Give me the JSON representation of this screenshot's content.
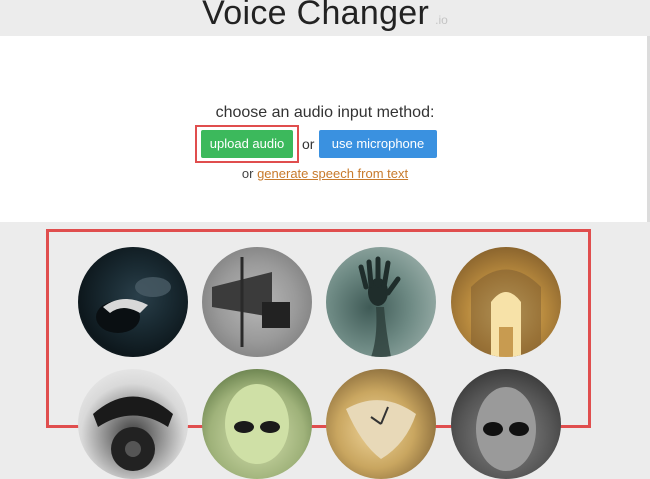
{
  "header": {
    "title": "Voice Changer",
    "suffix": ".io"
  },
  "input_panel": {
    "prompt": "choose an audio input method:",
    "upload_label": "upload audio",
    "or_text": "or",
    "mic_label": "use microphone",
    "or_prefix": "or",
    "generate_link": "generate speech from text"
  },
  "voices": [
    {
      "name": "dark-creature-thumbnail"
    },
    {
      "name": "megaphone-thumbnail"
    },
    {
      "name": "ghost-hand-thumbnail"
    },
    {
      "name": "cathedral-thumbnail"
    },
    {
      "name": "telephone-thumbnail"
    },
    {
      "name": "alien-thumbnail"
    },
    {
      "name": "melting-clock-thumbnail"
    },
    {
      "name": "grey-alien-thumbnail"
    }
  ],
  "colors": {
    "upload_green": "#3cb95c",
    "mic_blue": "#3a91e0",
    "highlight_red": "#e04e4e",
    "link_orange": "#c87a2b"
  }
}
